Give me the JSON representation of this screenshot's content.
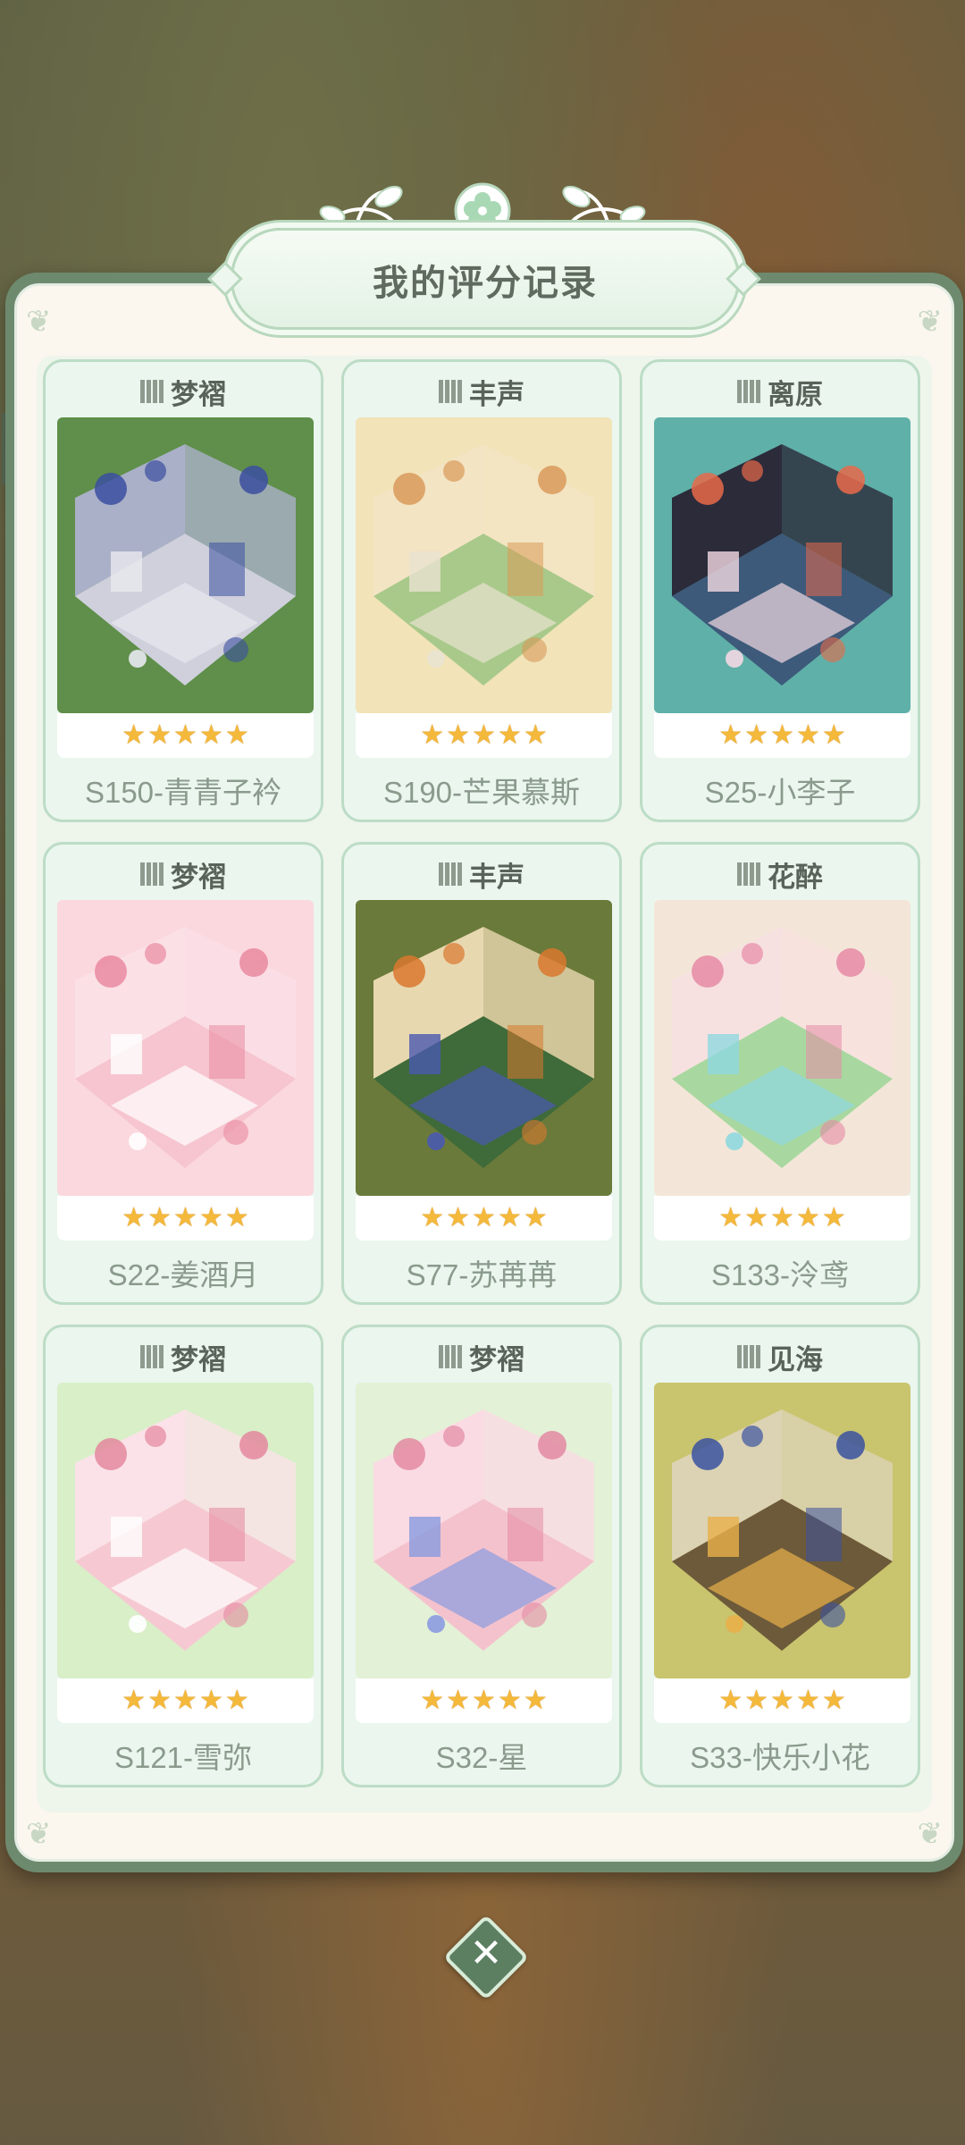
{
  "dialog": {
    "title": "我的评分记录",
    "close_icon": "close-icon"
  },
  "colors": {
    "panel_border": "#6e8a6e",
    "card_bg": "#eaf6ee",
    "star": "#f4b83b",
    "name_text": "#8a9a8c"
  },
  "records": [
    {
      "level": "梦褶",
      "name": "S150-青青子衿",
      "rating": 5,
      "theme": "blue-gray"
    },
    {
      "level": "丰声",
      "name": "S190-芒果慕斯",
      "rating": 5,
      "theme": "cream-cottage"
    },
    {
      "level": "离原",
      "name": "S25-小李子",
      "rating": 5,
      "theme": "teal-night"
    },
    {
      "level": "梦褶",
      "name": "S22-姜酒月",
      "rating": 5,
      "theme": "pink"
    },
    {
      "level": "丰声",
      "name": "S77-苏苒苒",
      "rating": 5,
      "theme": "autumn-cottage"
    },
    {
      "level": "花醉",
      "name": "S133-泠鸢",
      "rating": 5,
      "theme": "pink-garden"
    },
    {
      "level": "梦褶",
      "name": "S121-雪弥",
      "rating": 5,
      "theme": "pink-green"
    },
    {
      "level": "梦褶",
      "name": "S32-星",
      "rating": 5,
      "theme": "pink-blue"
    },
    {
      "level": "见海",
      "name": "S33-快乐小花",
      "rating": 5,
      "theme": "olive-house"
    }
  ]
}
